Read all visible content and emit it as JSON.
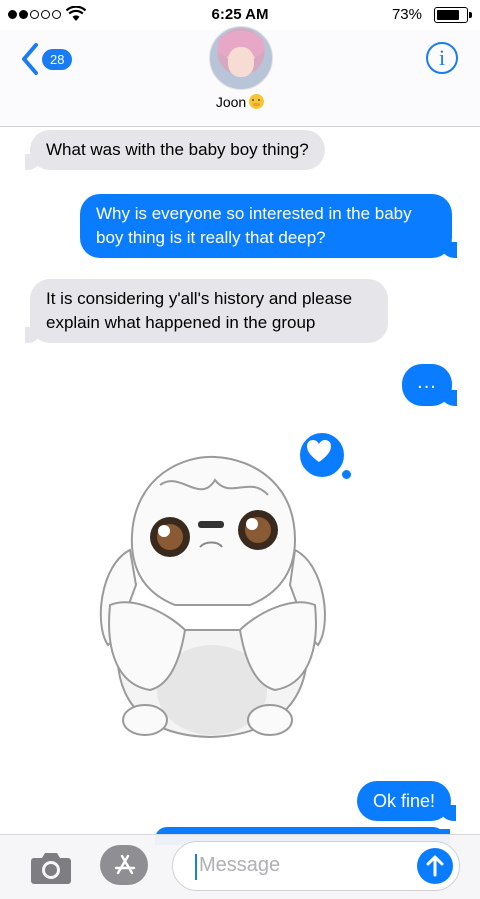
{
  "status_bar": {
    "time": "6:25 AM",
    "battery_percent": "73%",
    "battery_level": 0.73,
    "signal_bars_filled": 2,
    "signal_bars_total": 5
  },
  "header": {
    "back_count": "28",
    "contact_name": "Joon",
    "accent_color": "#0a7cff"
  },
  "messages": [
    {
      "direction": "incoming",
      "text": "What was with the baby boy thing?"
    },
    {
      "direction": "outgoing",
      "text": "Why is everyone so interested in the baby boy thing is it really that deep?"
    },
    {
      "direction": "incoming",
      "text": "It is considering y'all's history and please explain what happened in the group"
    },
    {
      "direction": "outgoing",
      "text": "..."
    },
    {
      "direction": "incoming",
      "type": "sticker",
      "icon": "white-puppy-sticker",
      "reaction": "heart-icon"
    },
    {
      "direction": "outgoing",
      "text": "Ok fine!"
    }
  ],
  "input_bar": {
    "placeholder": "Message",
    "camera_icon": "camera-icon",
    "apps_icon": "app-store-icon",
    "send_icon": "send-arrow-up-icon"
  }
}
